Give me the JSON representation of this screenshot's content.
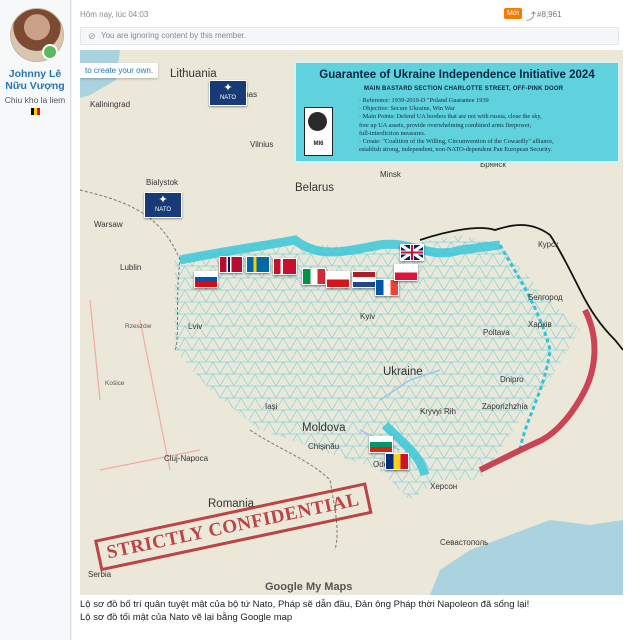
{
  "user": {
    "name": "Johnny Lê\nNữu Vượng",
    "name_line1": "Johnny Lê",
    "name_line2": "Nữu Vượng",
    "title": "Chiu kho la liem",
    "flag_colors": [
      "#000000",
      "#f8d000",
      "#e30613"
    ]
  },
  "post": {
    "time": "Hôm nay, lúc 04:03",
    "badge": "Mới",
    "post_number": "#8,961",
    "ignore_notice": "You are ignoring content by this member.",
    "caption_line1": "Lộ sơ đồ bố trí quân tuyệt mật của bộ tứ Nato, Pháp sẽ dẫn đầu, Đản ông Pháp thời Napoleon đã sống lại!",
    "caption_line2": "Lộ sơ đồ tối mật của Nato vẽ lại bằng Google map"
  },
  "map": {
    "create_link": "to create your own.",
    "logo": "Google My Maps",
    "stamp": "STRICTLY CONFIDENTIAL",
    "nato_label": "NATO",
    "labels": {
      "lithuania": "Lithuania",
      "vilnius": "Vilnius",
      "minsk": "Minsk",
      "belarus": "Belarus",
      "bialystok": "Bialystok",
      "warsaw": "Warsaw",
      "lublin": "Lublin",
      "ukraine": "Ukraine",
      "moldova": "Moldova",
      "romania": "Romania",
      "kyiv": "Kyiv",
      "lviv": "Lviv",
      "odesa": "Odesa",
      "kharkiv": "Харків",
      "poltava": "Poltava",
      "dnipro": "Dnipro",
      "zaporizhzhia": "Zaporizhzhia",
      "kherson": "Херсон",
      "krivyi_rih": "Kryvyi Rih",
      "chisinau": "Chișinău",
      "cluj": "Cluj-Napoca",
      "serbia": "Serbia",
      "sevastopol": "Севастополь",
      "kursk": "Курск",
      "belgorod": "Белгород",
      "bryansk": "Брянск",
      "kaliningrad": "Kaliningrad",
      "kaunas": "Kaunas",
      "rzeszow": "Rzeszów",
      "kosice": "Košice",
      "iasi": "Iași"
    },
    "colors": {
      "nato_blue": "#183b78",
      "defense_line": "#31c4d8",
      "front_line": "#c83246",
      "border": "#111111"
    }
  },
  "document": {
    "title": "Guarantee of Ukraine Independence Initiative 2024",
    "subtitle": "MAIN BASTARD SECTION CHARLOTTE STREET, OFF-PINK DOOR",
    "seal": "MI6",
    "lines": [
      "· Reference:  1939-2019-D  \"Poland Guarantee 1939",
      "· Objective:  Secure Ukraine, Win War",
      "· Main Points:  Defend UA borders that are not with russia, close the sky,",
      "  free up UA assets, provide overwhelming combined arms firepower,",
      "  full-interdiction measures.",
      "· Create:  \"Coalition of the Willing, Circumvention of the Cowardly\" alliance,",
      "  establish strong, independent, non-NATO-dependent Pan European Security."
    ]
  }
}
